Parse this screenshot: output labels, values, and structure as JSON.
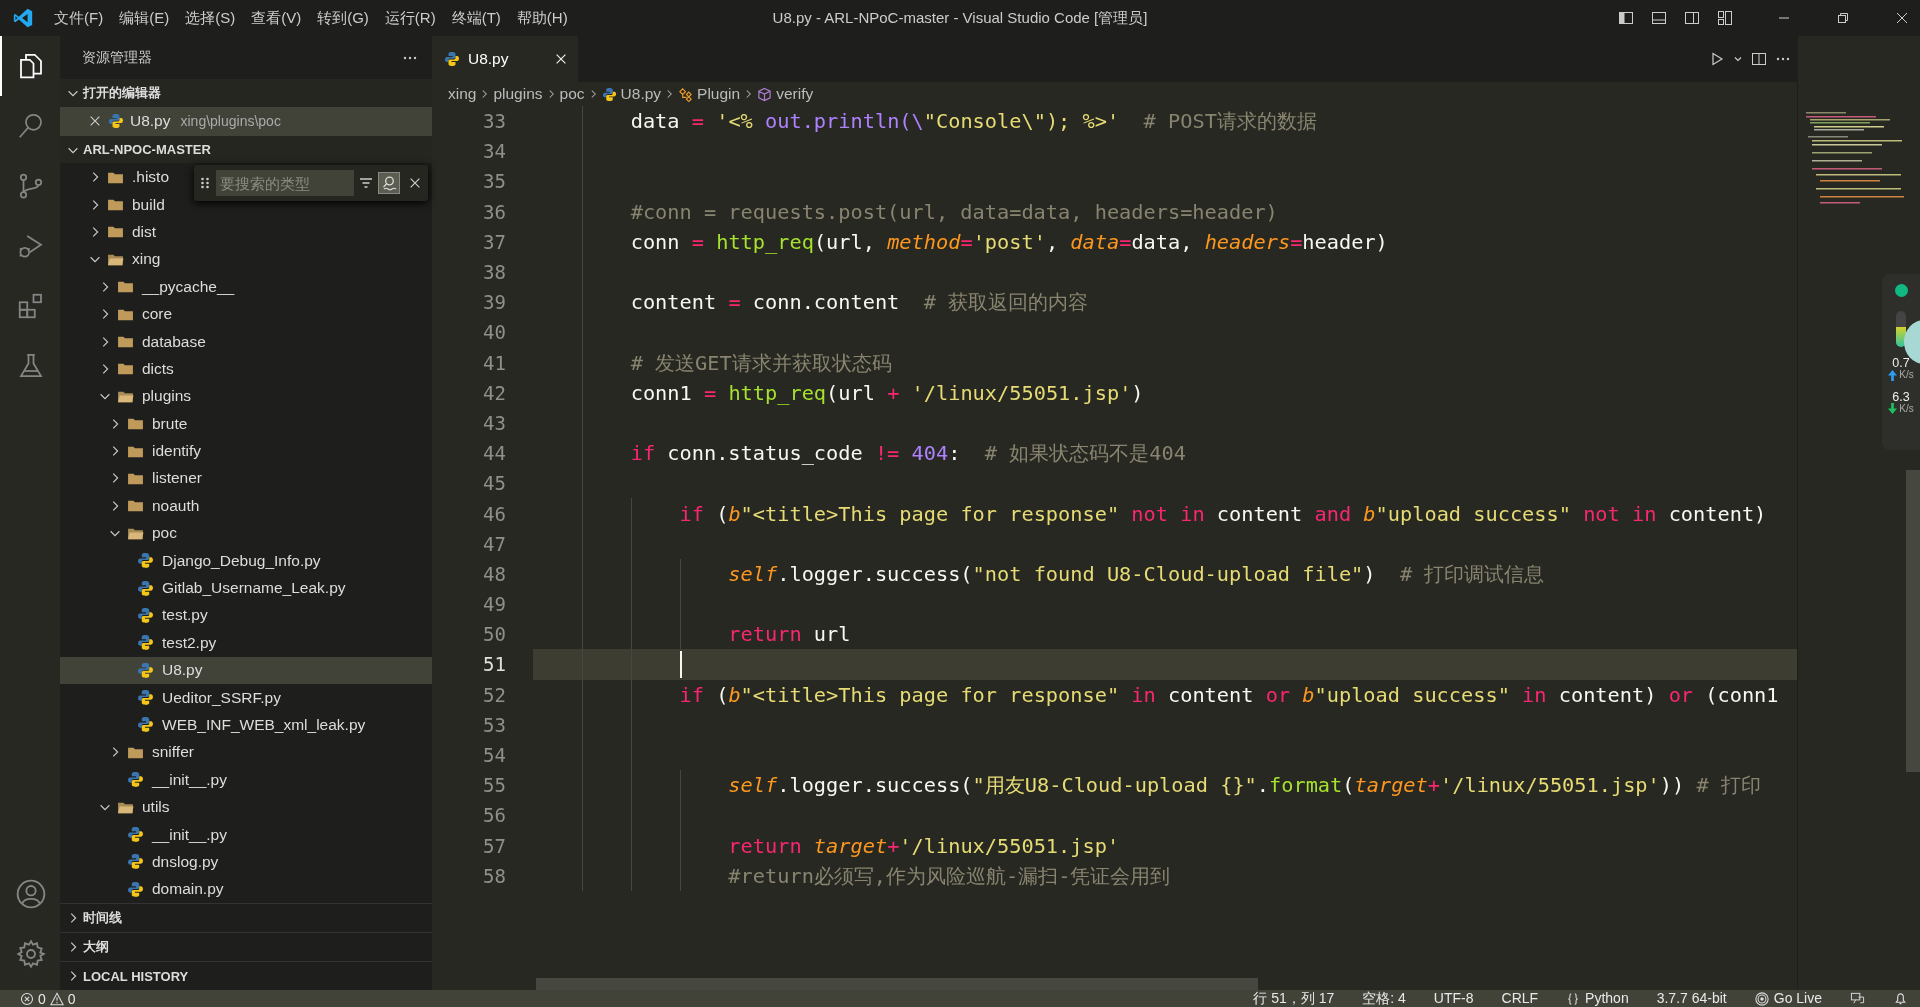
{
  "window": {
    "title": "U8.py - ARL-NPoC-master - Visual Studio Code [管理员]",
    "menu": [
      "文件(F)",
      "编辑(E)",
      "选择(S)",
      "查看(V)",
      "转到(G)",
      "运行(R)",
      "终端(T)",
      "帮助(H)"
    ]
  },
  "activity_bar": [
    {
      "kind": "explorer",
      "selected": true
    },
    {
      "kind": "search",
      "selected": false
    },
    {
      "kind": "source-control",
      "selected": false
    },
    {
      "kind": "run-debug",
      "selected": false
    },
    {
      "kind": "extensions",
      "selected": false
    },
    {
      "kind": "testing",
      "selected": false
    }
  ],
  "sidebar": {
    "title": "资源管理器",
    "open_editors": {
      "title": "打开的编辑器",
      "expanded": true,
      "items": [
        {
          "name": "U8.py",
          "path": "xing\\plugins\\poc",
          "selected": true
        }
      ]
    },
    "project": {
      "title": "ARL-NPOC-MASTER",
      "expanded": true,
      "tree": [
        {
          "name": ".histo",
          "kind": "folder",
          "expanded": false,
          "selected": false
        },
        {
          "name": "build",
          "kind": "folder",
          "expanded": false,
          "selected": false
        },
        {
          "name": "dist",
          "kind": "folder",
          "expanded": false,
          "selected": false
        },
        {
          "name": "xing",
          "kind": "folder",
          "expanded": true,
          "selected": false,
          "children": [
            {
              "name": "__pycache__",
              "kind": "folder",
              "expanded": false,
              "selected": false
            },
            {
              "name": "core",
              "kind": "folder",
              "expanded": false,
              "selected": false
            },
            {
              "name": "database",
              "kind": "folder",
              "expanded": false,
              "selected": false
            },
            {
              "name": "dicts",
              "kind": "folder",
              "expanded": false,
              "selected": false
            },
            {
              "name": "plugins",
              "kind": "folder",
              "expanded": true,
              "selected": false,
              "children": [
                {
                  "name": "brute",
                  "kind": "folder",
                  "expanded": false,
                  "selected": false
                },
                {
                  "name": "identify",
                  "kind": "folder",
                  "expanded": false,
                  "selected": false
                },
                {
                  "name": "listener",
                  "kind": "folder",
                  "expanded": false,
                  "selected": false
                },
                {
                  "name": "noauth",
                  "kind": "folder",
                  "expanded": false,
                  "selected": false
                },
                {
                  "name": "poc",
                  "kind": "folder",
                  "expanded": true,
                  "selected": false,
                  "children": [
                    {
                      "name": "Django_Debug_Info.py",
                      "kind": "python",
                      "selected": false
                    },
                    {
                      "name": "Gitlab_Username_Leak.py",
                      "kind": "python",
                      "selected": false
                    },
                    {
                      "name": "test.py",
                      "kind": "python",
                      "selected": false
                    },
                    {
                      "name": "test2.py",
                      "kind": "python",
                      "selected": false
                    },
                    {
                      "name": "U8.py",
                      "kind": "python",
                      "selected": true
                    },
                    {
                      "name": "Ueditor_SSRF.py",
                      "kind": "python",
                      "selected": false
                    },
                    {
                      "name": "WEB_INF_WEB_xml_leak.py",
                      "kind": "python",
                      "selected": false
                    }
                  ]
                },
                {
                  "name": "sniffer",
                  "kind": "folder",
                  "expanded": false,
                  "selected": false
                },
                {
                  "name": "__init__.py",
                  "kind": "python",
                  "selected": false
                }
              ]
            },
            {
              "name": "utils",
              "kind": "folder",
              "expanded": true,
              "selected": false,
              "children": [
                {
                  "name": "__init__.py",
                  "kind": "python",
                  "selected": false
                },
                {
                  "name": "dnslog.py",
                  "kind": "python",
                  "selected": false
                },
                {
                  "name": "domain.py",
                  "kind": "python",
                  "selected": false
                }
              ]
            }
          ]
        }
      ]
    },
    "sections": [
      {
        "title": "时间线",
        "expanded": false
      },
      {
        "title": "大纲",
        "expanded": false
      },
      {
        "title": "LOCAL HISTORY",
        "expanded": false
      }
    ]
  },
  "find_widget": {
    "placeholder": "要搜索的类型"
  },
  "tabs": [
    {
      "label": "U8.py",
      "selected": true
    }
  ],
  "breadcrumb": [
    {
      "label": "xing",
      "kind": "folder"
    },
    {
      "label": "plugins",
      "kind": "folder"
    },
    {
      "label": "poc",
      "kind": "folder"
    },
    {
      "label": "U8.py",
      "kind": "python"
    },
    {
      "label": "Plugin",
      "kind": "class"
    },
    {
      "label": "verify",
      "kind": "method"
    }
  ],
  "editor": {
    "lines": [
      {
        "number": "33",
        "current": false,
        "tokens": [
          {
            "text": "        data ",
            "kind": "id"
          },
          {
            "text": "=",
            "kind": "op"
          },
          {
            "text": " '<% ",
            "kind": "str"
          },
          {
            "text": "out.println(\\",
            "kind": "num"
          },
          {
            "text": "\"Console\\\"",
            "kind": "str"
          },
          {
            "text": "); %>'",
            "kind": "str"
          },
          {
            "text": "  # POST请求的数据",
            "kind": "cmt"
          }
        ]
      },
      {
        "number": "34",
        "current": false
      },
      {
        "number": "35",
        "current": false
      },
      {
        "number": "36",
        "current": false,
        "tokens": [
          {
            "text": "        #conn = requests.post(url, data=data, headers=header)",
            "kind": "cmt"
          }
        ]
      },
      {
        "number": "37",
        "current": false,
        "tokens": [
          {
            "text": "        conn ",
            "kind": "id"
          },
          {
            "text": "=",
            "kind": "op"
          },
          {
            "text": " http_req",
            "kind": "fn"
          },
          {
            "text": "(url, ",
            "kind": "id"
          },
          {
            "text": "method",
            "kind": "param"
          },
          {
            "text": "=",
            "kind": "op"
          },
          {
            "text": "'post'",
            "kind": "str"
          },
          {
            "text": ", ",
            "kind": "id"
          },
          {
            "text": "data",
            "kind": "param"
          },
          {
            "text": "=",
            "kind": "op"
          },
          {
            "text": "data, ",
            "kind": "id"
          },
          {
            "text": "headers",
            "kind": "param"
          },
          {
            "text": "=",
            "kind": "op"
          },
          {
            "text": "header)",
            "kind": "id"
          }
        ]
      },
      {
        "number": "38",
        "current": false
      },
      {
        "number": "39",
        "current": false,
        "tokens": [
          {
            "text": "        content ",
            "kind": "id"
          },
          {
            "text": "=",
            "kind": "op"
          },
          {
            "text": " conn.content  ",
            "kind": "id"
          },
          {
            "text": "# 获取返回的内容",
            "kind": "cmt"
          }
        ]
      },
      {
        "number": "40",
        "current": false
      },
      {
        "number": "41",
        "current": false,
        "tokens": [
          {
            "text": "        # 发送GET请求并获取状态码",
            "kind": "cmt"
          }
        ]
      },
      {
        "number": "42",
        "current": false,
        "tokens": [
          {
            "text": "        conn1 ",
            "kind": "id"
          },
          {
            "text": "=",
            "kind": "op"
          },
          {
            "text": " http_req",
            "kind": "fn"
          },
          {
            "text": "(url ",
            "kind": "id"
          },
          {
            "text": "+",
            "kind": "op"
          },
          {
            "text": " '/linux/55051.jsp'",
            "kind": "str"
          },
          {
            "text": ")",
            "kind": "id"
          }
        ]
      },
      {
        "number": "43",
        "current": false
      },
      {
        "number": "44",
        "current": false,
        "tokens": [
          {
            "text": "        if",
            "kind": "kw"
          },
          {
            "text": " conn.status_code ",
            "kind": "id"
          },
          {
            "text": "!=",
            "kind": "op"
          },
          {
            "text": " 404",
            "kind": "num"
          },
          {
            "text": ":  ",
            "kind": "id"
          },
          {
            "text": "# 如果状态码不是404",
            "kind": "cmt"
          }
        ]
      },
      {
        "number": "45",
        "current": false
      },
      {
        "number": "46",
        "current": false,
        "tokens": [
          {
            "text": "            if",
            "kind": "kw"
          },
          {
            "text": " (",
            "kind": "id"
          },
          {
            "text": "b",
            "kind": "param"
          },
          {
            "text": "\"<title>This page for response\"",
            "kind": "str"
          },
          {
            "text": " not in",
            "kind": "kw"
          },
          {
            "text": " content ",
            "kind": "id"
          },
          {
            "text": "and",
            "kind": "kw"
          },
          {
            "text": " b",
            "kind": "param"
          },
          {
            "text": "\"upload success\"",
            "kind": "str"
          },
          {
            "text": " not in",
            "kind": "kw"
          },
          {
            "text": " content)",
            "kind": "id"
          }
        ]
      },
      {
        "number": "47",
        "current": false
      },
      {
        "number": "48",
        "current": false,
        "tokens": [
          {
            "text": "                self",
            "kind": "param"
          },
          {
            "text": ".logger.success(",
            "kind": "id"
          },
          {
            "text": "\"not found U8-Cloud-upload file\"",
            "kind": "str"
          },
          {
            "text": ")  ",
            "kind": "id"
          },
          {
            "text": "# 打印调试信息",
            "kind": "cmt"
          }
        ]
      },
      {
        "number": "49",
        "current": false
      },
      {
        "number": "50",
        "current": false,
        "tokens": [
          {
            "text": "                return",
            "kind": "kw"
          },
          {
            "text": " url",
            "kind": "id"
          }
        ]
      },
      {
        "number": "51",
        "current": true
      },
      {
        "number": "52",
        "current": false,
        "tokens": [
          {
            "text": "            if",
            "kind": "kw"
          },
          {
            "text": " (",
            "kind": "id"
          },
          {
            "text": "b",
            "kind": "param"
          },
          {
            "text": "\"<title>This page for response\"",
            "kind": "str"
          },
          {
            "text": " in",
            "kind": "kw"
          },
          {
            "text": " content ",
            "kind": "id"
          },
          {
            "text": "or",
            "kind": "kw"
          },
          {
            "text": " b",
            "kind": "param"
          },
          {
            "text": "\"upload success\"",
            "kind": "str"
          },
          {
            "text": " in",
            "kind": "kw"
          },
          {
            "text": " content) ",
            "kind": "id"
          },
          {
            "text": "or",
            "kind": "kw"
          },
          {
            "text": " (conn1",
            "kind": "id"
          }
        ]
      },
      {
        "number": "53",
        "current": false
      },
      {
        "number": "54",
        "current": false
      },
      {
        "number": "55",
        "current": false,
        "tokens": [
          {
            "text": "                self",
            "kind": "param"
          },
          {
            "text": ".logger.success(",
            "kind": "id"
          },
          {
            "text": "\"用友U8-Cloud-upload {}\"",
            "kind": "str"
          },
          {
            "text": ".",
            "kind": "id"
          },
          {
            "text": "format",
            "kind": "fn"
          },
          {
            "text": "(",
            "kind": "id"
          },
          {
            "text": "target",
            "kind": "param"
          },
          {
            "text": "+",
            "kind": "op"
          },
          {
            "text": "'/linux/55051.jsp'",
            "kind": "str"
          },
          {
            "text": ")) ",
            "kind": "id"
          },
          {
            "text": "# 打印",
            "kind": "cmt"
          }
        ]
      },
      {
        "number": "56",
        "current": false
      },
      {
        "number": "57",
        "current": false,
        "tokens": [
          {
            "text": "                return",
            "kind": "kw"
          },
          {
            "text": " target",
            "kind": "param"
          },
          {
            "text": "+",
            "kind": "op"
          },
          {
            "text": "'/linux/55051.jsp'",
            "kind": "str"
          }
        ]
      },
      {
        "number": "58",
        "current": false,
        "tokens": [
          {
            "text": "                #return必须写,作为风险巡航-漏扫-凭证会用到",
            "kind": "cmt"
          }
        ]
      }
    ]
  },
  "net_widget": {
    "upload": "0.7",
    "upload_unit": "K/s",
    "download": "6.3",
    "download_unit": "K/s"
  },
  "status_bar": {
    "errors": "0",
    "warnings": "0",
    "items": [
      {
        "label": "行 51，列 17",
        "kind": "text"
      },
      {
        "label": "空格: 4",
        "kind": "text"
      },
      {
        "label": "UTF-8",
        "kind": "text"
      },
      {
        "label": "CRLF",
        "kind": "text"
      },
      {
        "label": "Python",
        "kind": "language"
      },
      {
        "label": "3.7.7 64-bit",
        "kind": "text"
      },
      {
        "label": "Go Live",
        "kind": "live"
      }
    ]
  }
}
